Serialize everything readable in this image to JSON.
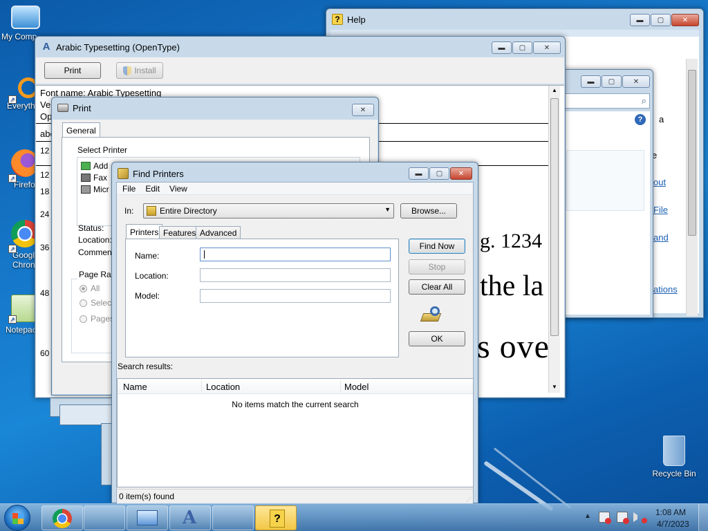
{
  "desktop": {
    "icons": [
      {
        "label": "My Comp",
        "icon": "computer-icon"
      },
      {
        "label": "Everyth",
        "icon": "everything-search-icon"
      },
      {
        "label": "Firefo",
        "icon": "firefox-icon"
      },
      {
        "label": "Googl Chron",
        "icon": "chrome-icon"
      },
      {
        "label": "Notepac",
        "icon": "notepad-icon"
      },
      {
        "label": "Recycle Bin",
        "icon": "recycle-bin-icon"
      }
    ]
  },
  "help_window": {
    "title": "Help",
    "side_letters": [
      "a",
      "e"
    ],
    "links": [
      "out",
      "File",
      "and",
      "ations"
    ]
  },
  "font_window": {
    "title": "Arabic Typesetting (OpenType)",
    "print_label": "Print",
    "install_label": "Install",
    "font_name": "Font name: Arabic Typesetting",
    "line2": "Ve",
    "line3": "Op",
    "line4": "abc",
    "sizes": [
      "12",
      "12",
      "18",
      "24",
      "36",
      "48",
      "60"
    ],
    "sample_36": "g. 1234",
    "sample_48": "the la",
    "sample_60": "s ove"
  },
  "print_dialog": {
    "title": "Print",
    "tab_general": "General",
    "select_printer_label": "Select Printer",
    "printers": [
      "Add",
      "Fax",
      "Micr"
    ],
    "status_label": "Status:",
    "location_label": "Location:",
    "comment_label": "Comment:",
    "page_range_label": "Page Rang",
    "range_options": [
      "All",
      "Selecti",
      "Pages"
    ]
  },
  "find_printers": {
    "title": "Find Printers",
    "menu": [
      "File",
      "Edit",
      "View"
    ],
    "in_label": "In:",
    "in_value": "Entire Directory",
    "browse_label": "Browse...",
    "tabs": [
      "Printers",
      "Features",
      "Advanced"
    ],
    "name_label": "Name:",
    "name_value": "",
    "location_label": "Location:",
    "model_label": "Model:",
    "find_now_label": "Find Now",
    "stop_label": "Stop",
    "clear_all_label": "Clear All",
    "ok_label": "OK",
    "search_results_label": "Search results:",
    "columns": [
      "Name",
      "Location",
      "Model"
    ],
    "empty_message": "No items match the current search",
    "status": "0 item(s) found"
  },
  "taskbar": {
    "time": "1:08 AM",
    "date": "4/7/2023"
  },
  "colors": {
    "desktop": "#1677c9",
    "close_button": "#c6452e",
    "taskbar_active": "#f2c744"
  }
}
